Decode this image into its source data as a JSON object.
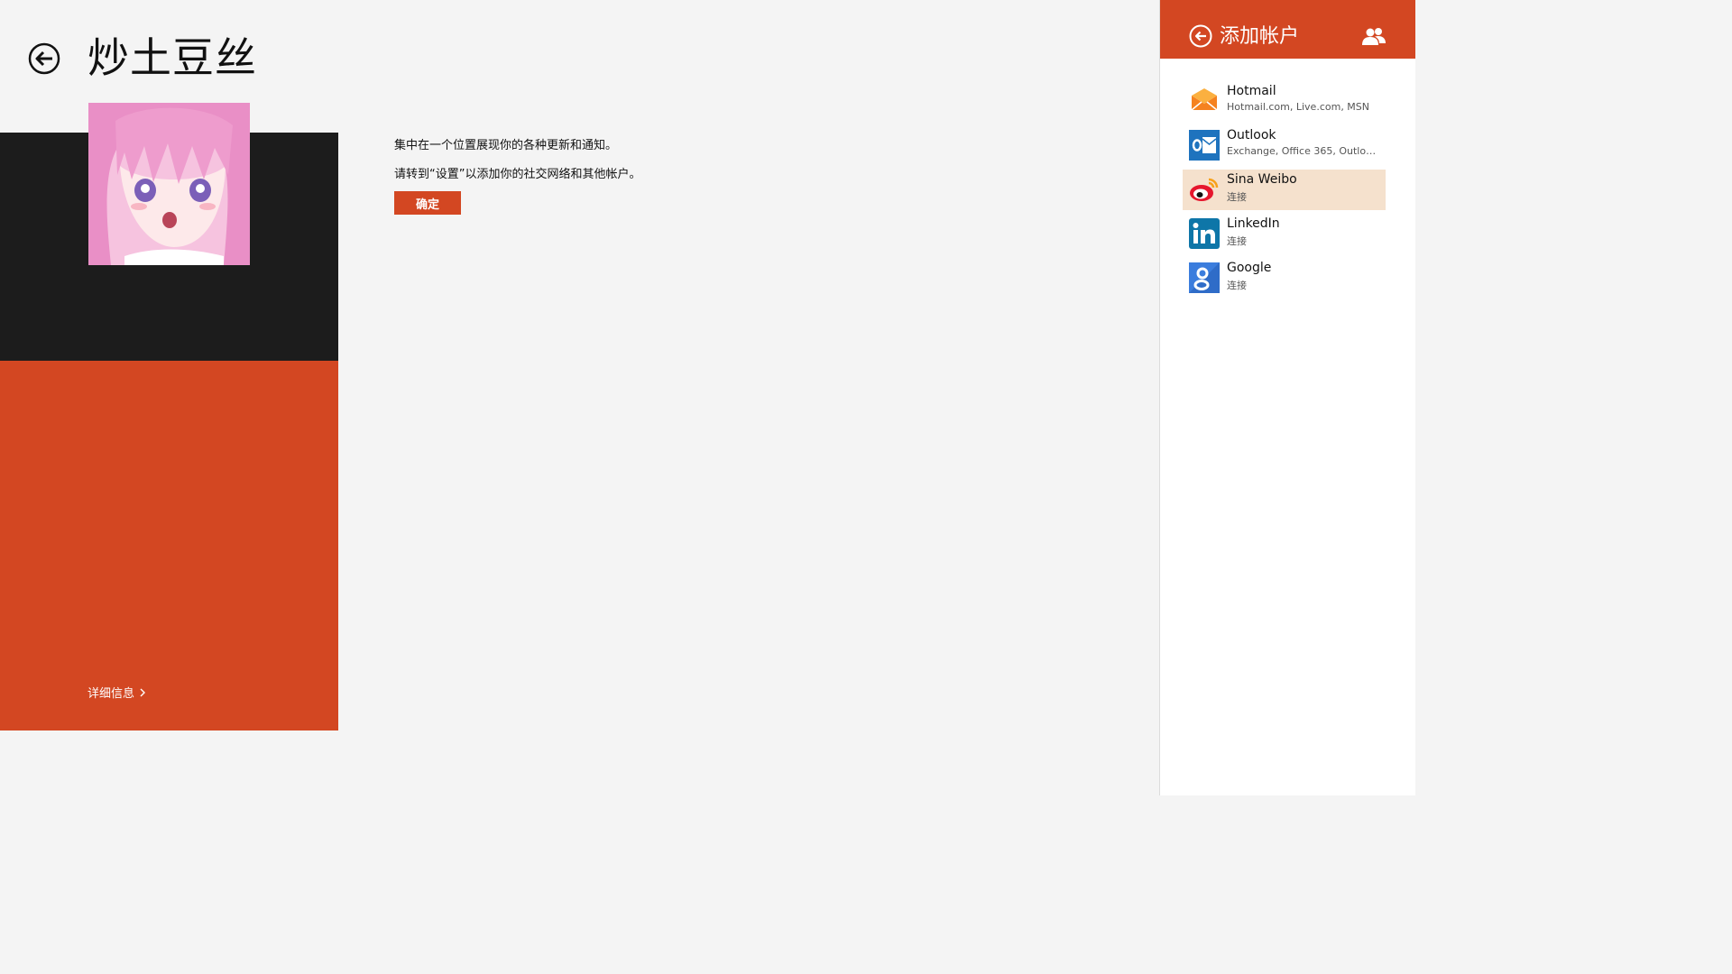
{
  "profile": {
    "name": "炒土豆丝",
    "details_label": "详细信息"
  },
  "message": {
    "line1": "集中在一个位置展现你的各种更新和通知。",
    "line2": "请转到“设置”以添加你的社交网络和其他帐户。",
    "ok_label": "确定"
  },
  "pane": {
    "title": "添加帐户",
    "accounts": [
      {
        "name": "Hotmail",
        "subtitle": "Hotmail.com, Live.com, MSN",
        "icon": "hotmail-icon"
      },
      {
        "name": "Outlook",
        "subtitle": "Exchange, Office 365, Outlook.c...",
        "icon": "outlook-icon"
      },
      {
        "name": "Sina Weibo",
        "subtitle": "连接",
        "icon": "weibo-icon",
        "selected": true
      },
      {
        "name": "LinkedIn",
        "subtitle": "连接",
        "icon": "linkedin-icon"
      },
      {
        "name": "Google",
        "subtitle": "连接",
        "icon": "google-icon"
      }
    ]
  },
  "colors": {
    "accent": "#d34722",
    "dark_panel": "#1c1c1c",
    "background": "#f4f4f4",
    "selected_row": "#f5e1cd"
  }
}
